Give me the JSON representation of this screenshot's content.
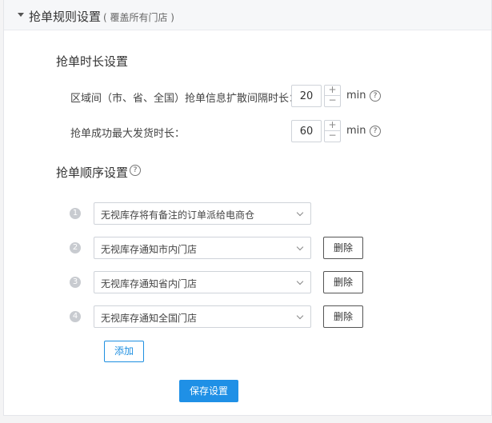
{
  "header": {
    "title": "抢单规则设置",
    "subtitle": "( 覆盖所有门店 )"
  },
  "duration_section": {
    "title": "抢单时长设置",
    "fields": [
      {
        "label": "区域间（市、省、全国）抢单信息扩散间隔时长：",
        "value": "20",
        "unit": "min"
      },
      {
        "label": "抢单成功最大发货时长：",
        "value": "60",
        "unit": "min"
      }
    ]
  },
  "order_section": {
    "title": "抢单顺序设置",
    "rules": [
      {
        "index": "1",
        "text": "无视库存将有备注的订单派给电商仓"
      },
      {
        "index": "2",
        "text": "无视库存通知市内门店",
        "delete_label": "删除"
      },
      {
        "index": "3",
        "text": "无视库存通知省内门店",
        "delete_label": "删除"
      },
      {
        "index": "4",
        "text": "无视库存通知全国门店",
        "delete_label": "删除"
      }
    ],
    "add_label": "添加"
  },
  "save_label": "保存设置",
  "icons": {
    "help": "?",
    "plus": "+",
    "minus": "−",
    "collapse": "caret-down-icon"
  },
  "colors": {
    "primary": "#1f90e6",
    "header_bg": "#f6f7f9",
    "badge": "#c8cbd0"
  }
}
